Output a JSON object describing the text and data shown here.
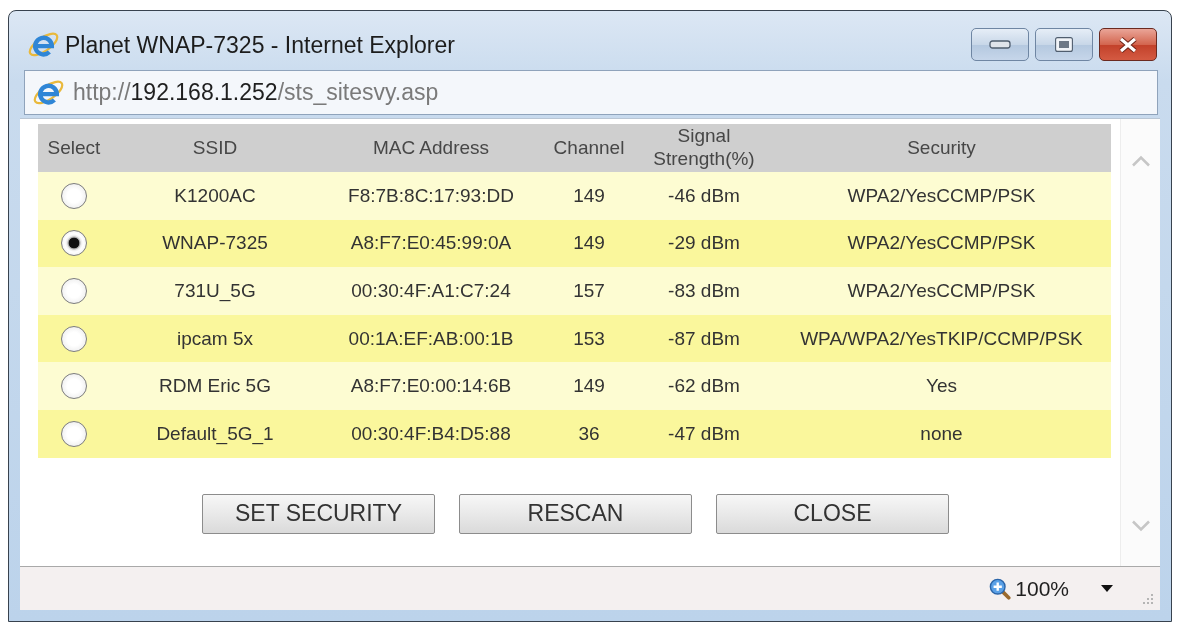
{
  "window": {
    "title": "Planet WNAP-7325 - Internet Explorer"
  },
  "address_bar": {
    "scheme": "http://",
    "host": "192.168.1.252",
    "path": "/sts_sitesvy.asp"
  },
  "table": {
    "columns": [
      "Select",
      "SSID",
      "MAC Address",
      "Channel",
      "Signal Strength(%)",
      "Security"
    ],
    "rows": [
      {
        "selected": false,
        "ssid": "K1200AC",
        "mac_address": "F8:7B:8C:17:93:DD",
        "channel": "149",
        "signal_strength": "-46 dBm",
        "security": "WPA2/YesCCMP/PSK"
      },
      {
        "selected": true,
        "ssid": "WNAP-7325",
        "mac_address": "A8:F7:E0:45:99:0A",
        "channel": "149",
        "signal_strength": "-29 dBm",
        "security": "WPA2/YesCCMP/PSK"
      },
      {
        "selected": false,
        "ssid": "731U_5G",
        "mac_address": "00:30:4F:A1:C7:24",
        "channel": "157",
        "signal_strength": "-83 dBm",
        "security": "WPA2/YesCCMP/PSK"
      },
      {
        "selected": false,
        "ssid": "ipcam 5x",
        "mac_address": "00:1A:EF:AB:00:1B",
        "channel": "153",
        "signal_strength": "-87 dBm",
        "security": "WPA/WPA2/YesTKIP/CCMP/PSK"
      },
      {
        "selected": false,
        "ssid": "RDM Eric 5G",
        "mac_address": "A8:F7:E0:00:14:6B",
        "channel": "149",
        "signal_strength": "-62 dBm",
        "security": "Yes"
      },
      {
        "selected": false,
        "ssid": "Default_5G_1",
        "mac_address": "00:30:4F:B4:D5:88",
        "channel": "36",
        "signal_strength": "-47 dBm",
        "security": "none"
      }
    ]
  },
  "buttons": [
    "SET SECURITY",
    "RESCAN",
    "CLOSE"
  ],
  "status_bar": {
    "zoom": "100%"
  }
}
